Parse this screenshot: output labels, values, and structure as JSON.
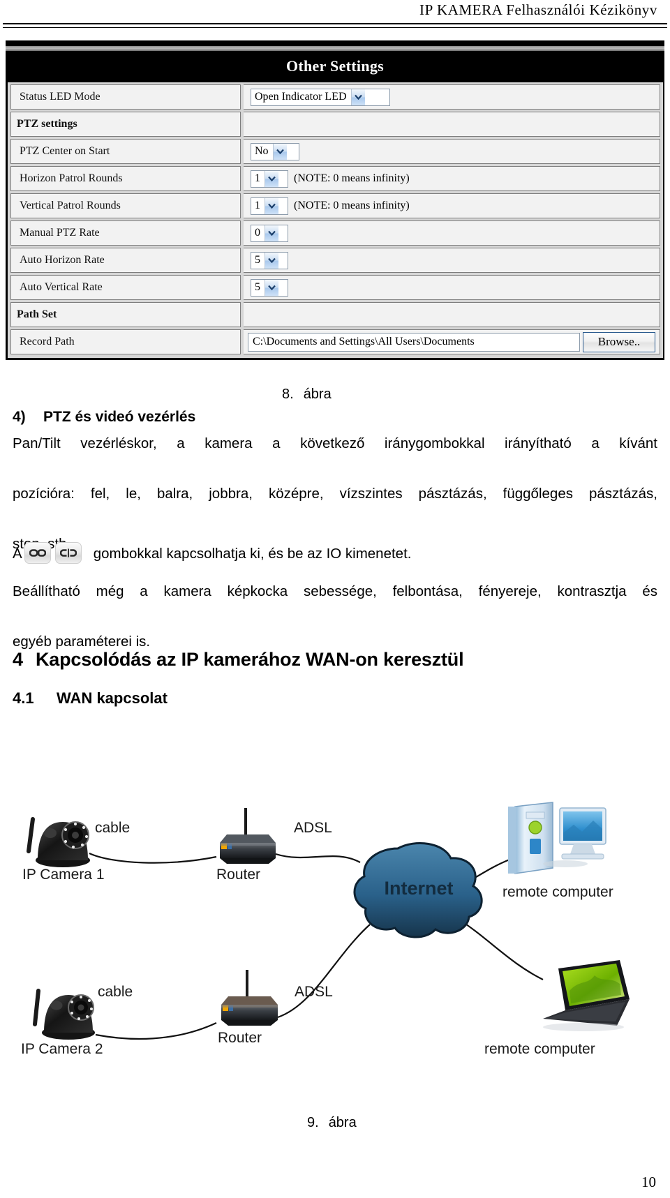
{
  "header": {
    "manual_title": "IP KAMERA Felhasználói Kézikönyv"
  },
  "screenshot": {
    "panel_title": "Other Settings",
    "rows": [
      {
        "label": "Status LED Mode",
        "control": "select",
        "value": "Open Indicator LED",
        "note": ""
      },
      {
        "label": "PTZ settings",
        "control": "section",
        "value": "",
        "note": ""
      },
      {
        "label": "PTZ Center on Start",
        "control": "select",
        "value": "No",
        "note": ""
      },
      {
        "label": "Horizon Patrol Rounds",
        "control": "select",
        "value": "1",
        "note": "(NOTE: 0 means infinity)"
      },
      {
        "label": "Vertical Patrol Rounds",
        "control": "select",
        "value": "1",
        "note": "(NOTE: 0 means infinity)"
      },
      {
        "label": "Manual PTZ Rate",
        "control": "select",
        "value": "0",
        "note": ""
      },
      {
        "label": "Auto Horizon Rate",
        "control": "select",
        "value": "5",
        "note": ""
      },
      {
        "label": "Auto Vertical Rate",
        "control": "select",
        "value": "5",
        "note": ""
      },
      {
        "label": "Path Set",
        "control": "section",
        "value": "",
        "note": ""
      },
      {
        "label": "Record Path",
        "control": "textbox",
        "value": "C:\\Documents and Settings\\All Users\\Documents",
        "button_label": "Browse..",
        "note": ""
      }
    ]
  },
  "figure8": {
    "number": "8.",
    "word": "ábra"
  },
  "section4": {
    "marker": "4)",
    "heading": "PTZ és videó vezérlés",
    "paragraph1_line1": "Pan/Tilt vezérléskor, a kamera a következő iránygombokkal irányítható a kívánt",
    "paragraph1_line2": "pozícióra: fel, le, balra, jobbra, középre, vízszintes pásztázás, függőleges pásztázás,",
    "paragraph1_line3": "stop, stb.",
    "io_prefix": "A",
    "io_suffix": "gombokkal kapcsolhatja ki, és be az IO kimenetet.",
    "paragraph2_line1": "Beállítható még a kamera képkocka sebessége, felbontása, fényereje, kontrasztja és",
    "paragraph2_line2": "egyéb paraméterei is."
  },
  "chapter4": {
    "marker": "4",
    "title": "Kapcsolódás az IP kamerához WAN-on keresztül",
    "sub_marker": "4.1",
    "sub_title": "WAN kapcsolat"
  },
  "diagram": {
    "labels": {
      "camera1": "IP Camera 1",
      "camera2": "IP Camera 2",
      "cable_top": "cable",
      "cable_bottom": "cable",
      "router_top": "Router",
      "router_bottom": "Router",
      "adsl_top": "ADSL",
      "adsl_bottom": "ADSL",
      "internet": "Internet",
      "remote_desktop": "remote computer",
      "remote_laptop": "remote computer"
    },
    "colors": {
      "cloud": "#1f4f72",
      "cloud_light": "#3f7ca8",
      "desktop_case": "#cfe2f2",
      "monitor_screen": "#3d9ad6",
      "laptop_screen": "#7ec400",
      "camera_body": "#1a1a1a"
    }
  },
  "figure9": {
    "number": "9.",
    "word": "ábra"
  },
  "footer": {
    "page_number": "10"
  }
}
